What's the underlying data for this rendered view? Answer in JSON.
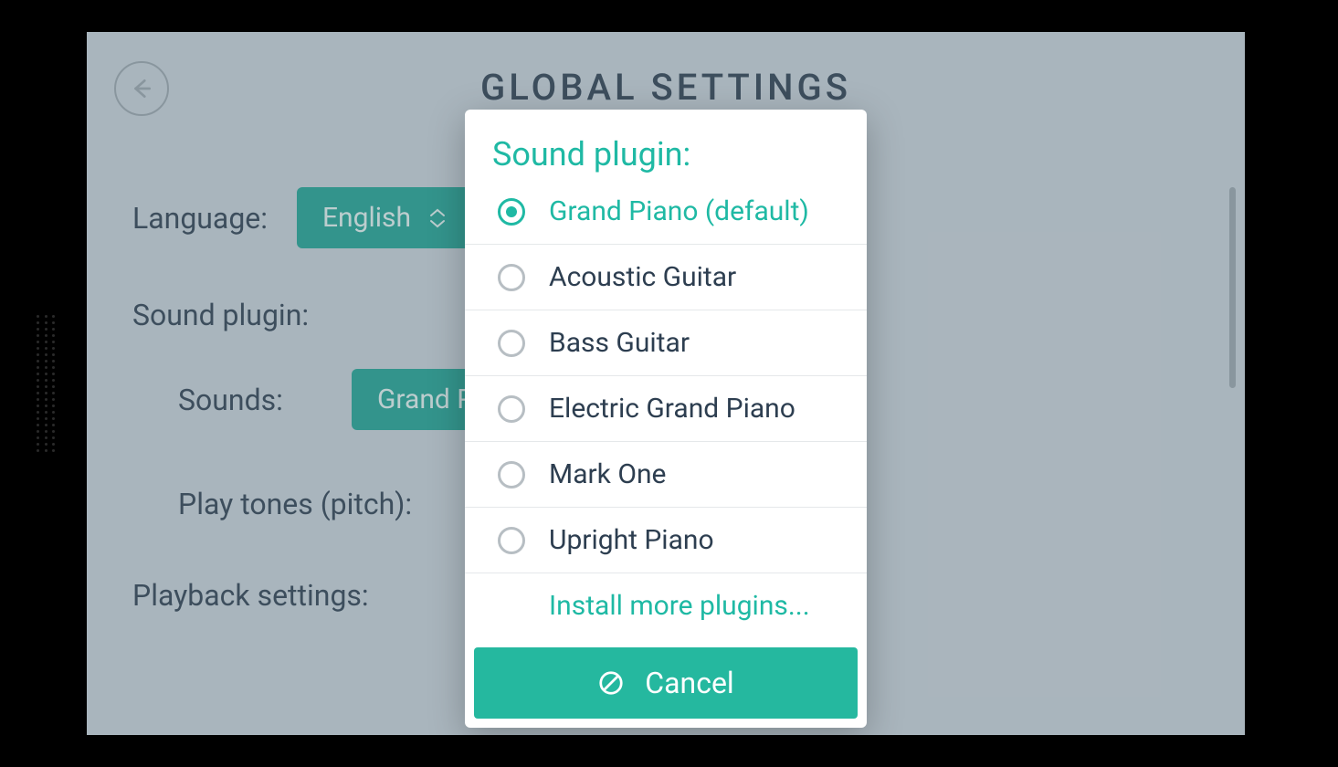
{
  "page": {
    "title": "GLOBAL SETTINGS"
  },
  "settings": {
    "language_label": "Language:",
    "language_value": "English",
    "sound_plugin_section": "Sound plugin:",
    "sounds_label": "Sounds:",
    "sounds_value": "Grand Piano (default)",
    "pitch_label": "Play tones (pitch):",
    "playback_section": "Playback settings:"
  },
  "modal": {
    "title": "Sound plugin:",
    "options": [
      {
        "label": "Grand Piano (default)",
        "selected": true
      },
      {
        "label": "Acoustic Guitar",
        "selected": false
      },
      {
        "label": "Bass Guitar",
        "selected": false
      },
      {
        "label": "Electric Grand Piano",
        "selected": false
      },
      {
        "label": "Mark One",
        "selected": false
      },
      {
        "label": "Upright Piano",
        "selected": false
      }
    ],
    "install_link": "Install more plugins...",
    "cancel": "Cancel"
  }
}
